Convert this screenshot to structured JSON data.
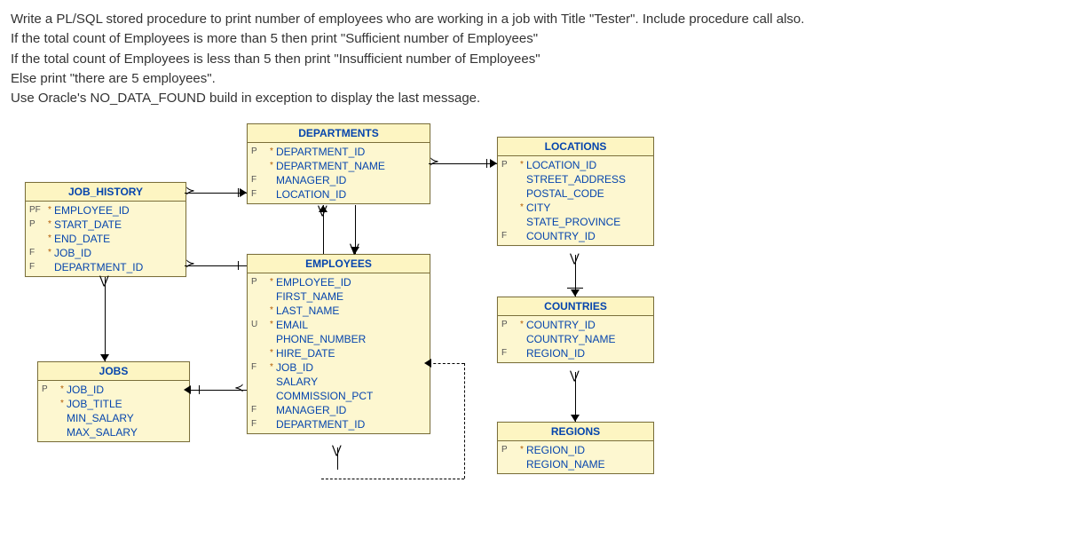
{
  "question": {
    "line1": "Write a PL/SQL stored procedure to print number of employees who are working in a job with Title \"Tester\". Include procedure call also.",
    "line2": "If the total count of Employees is more than 5 then print \"Sufficient number of Employees\"",
    "line3": "If the total count of Employees is less than 5 then print \"Insufficient number of Employees\"",
    "line4": "Else print \"there are 5 employees\".",
    "line5": "Use Oracle's NO_DATA_FOUND build in exception to display the last message."
  },
  "entities": {
    "job_history": {
      "title": "JOB_HISTORY",
      "cols": [
        {
          "key": "PF",
          "mark": "*",
          "name": "EMPLOYEE_ID"
        },
        {
          "key": "P",
          "mark": "*",
          "name": "START_DATE"
        },
        {
          "key": "",
          "mark": "*",
          "name": "END_DATE"
        },
        {
          "key": "F",
          "mark": "*",
          "name": "JOB_ID"
        },
        {
          "key": "F",
          "mark": "",
          "name": "DEPARTMENT_ID"
        }
      ]
    },
    "jobs": {
      "title": "JOBS",
      "cols": [
        {
          "key": "P",
          "mark": "*",
          "name": "JOB_ID"
        },
        {
          "key": "",
          "mark": "*",
          "name": "JOB_TITLE"
        },
        {
          "key": "",
          "mark": "",
          "name": "MIN_SALARY"
        },
        {
          "key": "",
          "mark": "",
          "name": "MAX_SALARY"
        }
      ]
    },
    "departments": {
      "title": "DEPARTMENTS",
      "cols": [
        {
          "key": "P",
          "mark": "*",
          "name": "DEPARTMENT_ID"
        },
        {
          "key": "",
          "mark": "*",
          "name": "DEPARTMENT_NAME"
        },
        {
          "key": "F",
          "mark": "",
          "name": "MANAGER_ID"
        },
        {
          "key": "F",
          "mark": "",
          "name": "LOCATION_ID"
        }
      ]
    },
    "employees": {
      "title": "EMPLOYEES",
      "cols": [
        {
          "key": "P",
          "mark": "*",
          "name": "EMPLOYEE_ID"
        },
        {
          "key": "",
          "mark": "",
          "name": "FIRST_NAME"
        },
        {
          "key": "",
          "mark": "*",
          "name": "LAST_NAME"
        },
        {
          "key": "U",
          "mark": "*",
          "name": "EMAIL"
        },
        {
          "key": "",
          "mark": "",
          "name": "PHONE_NUMBER"
        },
        {
          "key": "",
          "mark": "*",
          "name": "HIRE_DATE"
        },
        {
          "key": "F",
          "mark": "*",
          "name": "JOB_ID"
        },
        {
          "key": "",
          "mark": "",
          "name": "SALARY"
        },
        {
          "key": "",
          "mark": "",
          "name": "COMMISSION_PCT"
        },
        {
          "key": "F",
          "mark": "",
          "name": "MANAGER_ID"
        },
        {
          "key": "F",
          "mark": "",
          "name": "DEPARTMENT_ID"
        }
      ]
    },
    "locations": {
      "title": "LOCATIONS",
      "cols": [
        {
          "key": "P",
          "mark": "*",
          "name": "LOCATION_ID"
        },
        {
          "key": "",
          "mark": "",
          "name": "STREET_ADDRESS"
        },
        {
          "key": "",
          "mark": "",
          "name": "POSTAL_CODE"
        },
        {
          "key": "",
          "mark": "*",
          "name": "CITY"
        },
        {
          "key": "",
          "mark": "",
          "name": "STATE_PROVINCE"
        },
        {
          "key": "F",
          "mark": "",
          "name": "COUNTRY_ID"
        }
      ]
    },
    "countries": {
      "title": "COUNTRIES",
      "cols": [
        {
          "key": "P",
          "mark": "*",
          "name": "COUNTRY_ID"
        },
        {
          "key": "",
          "mark": "",
          "name": "COUNTRY_NAME"
        },
        {
          "key": "F",
          "mark": "",
          "name": "REGION_ID"
        }
      ]
    },
    "regions": {
      "title": "REGIONS",
      "cols": [
        {
          "key": "P",
          "mark": "*",
          "name": "REGION_ID"
        },
        {
          "key": "",
          "mark": "",
          "name": "REGION_NAME"
        }
      ]
    }
  }
}
